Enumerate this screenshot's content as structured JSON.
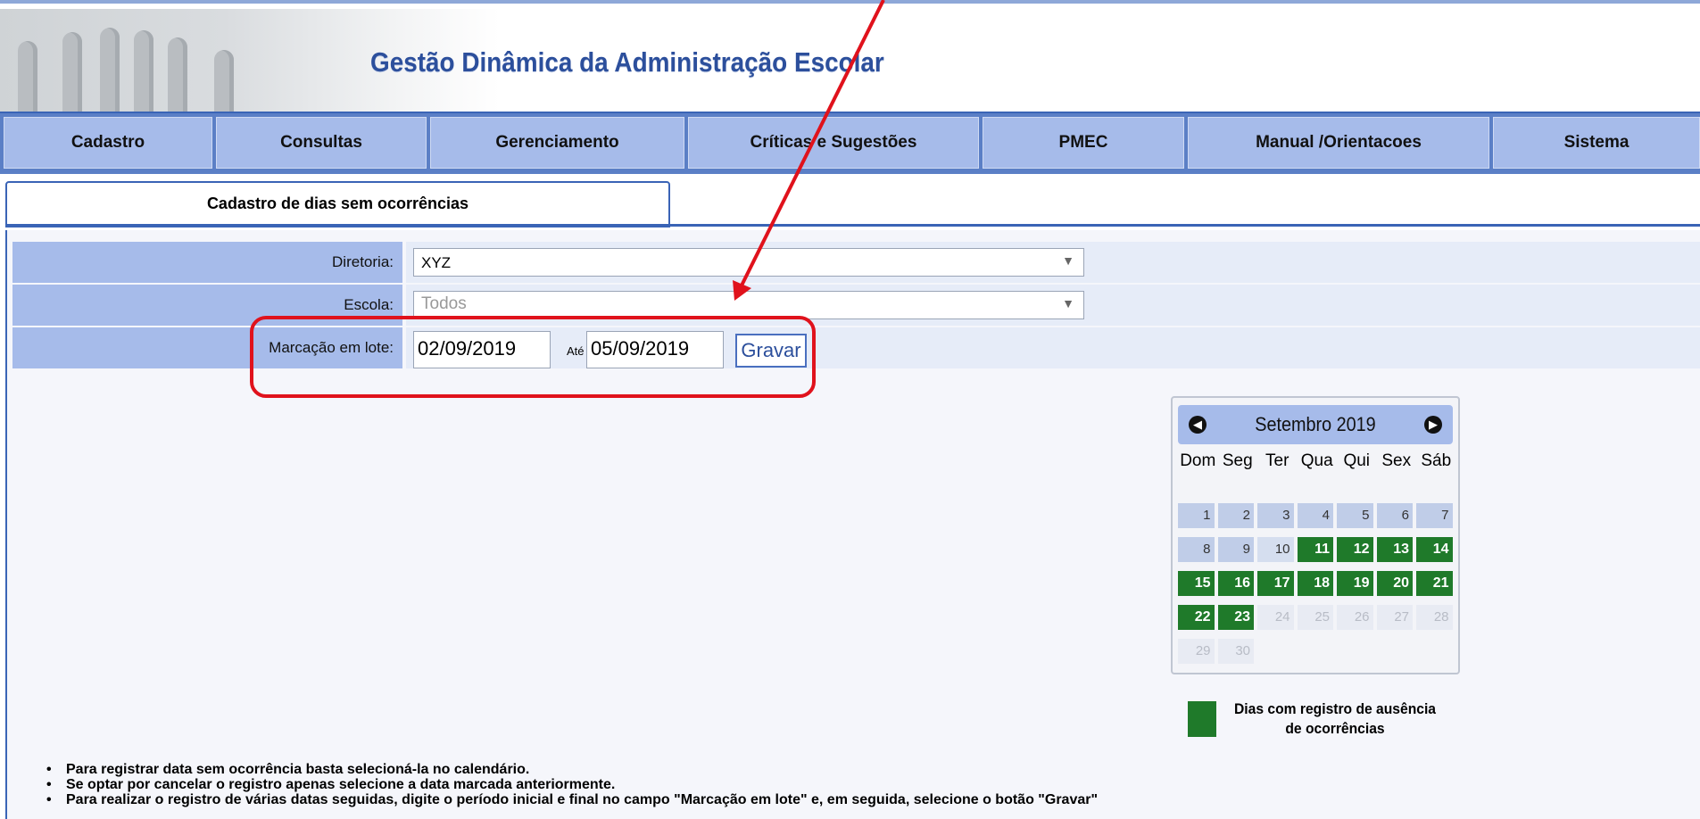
{
  "header": {
    "title": "Gestão Dinâmica da Administração Escolar"
  },
  "menu": [
    {
      "label": "Cadastro"
    },
    {
      "label": "Consultas"
    },
    {
      "label": "Gerenciamento"
    },
    {
      "label": "Críticas e Sugestões"
    },
    {
      "label": "PMEC"
    },
    {
      "label": "Manual /Orientacoes"
    },
    {
      "label": "Sistema"
    }
  ],
  "tab": {
    "label": "Cadastro de dias sem ocorrências"
  },
  "form": {
    "diretoria_label": "Diretoria:",
    "diretoria_value": "XYZ",
    "escola_label": "Escola:",
    "escola_value": "Todos",
    "lote_label": "Marcação em lote:",
    "date_from": "02/09/2019",
    "ate_label": "Até",
    "date_to": "05/09/2019",
    "gravar_label": "Gravar"
  },
  "calendar": {
    "title": "Setembro 2019",
    "prev_icon": "chevron-left-icon",
    "next_icon": "chevron-right-icon",
    "weekdays": [
      "Dom",
      "Seg",
      "Ter",
      "Qua",
      "Qui",
      "Sex",
      "Sáb"
    ],
    "weeks": [
      [
        {
          "d": "1",
          "s": "plain"
        },
        {
          "d": "2",
          "s": "plain"
        },
        {
          "d": "3",
          "s": "plain"
        },
        {
          "d": "4",
          "s": "plain"
        },
        {
          "d": "5",
          "s": "plain"
        },
        {
          "d": "6",
          "s": "plain"
        },
        {
          "d": "7",
          "s": "plain"
        }
      ],
      [
        {
          "d": "8",
          "s": "plain"
        },
        {
          "d": "9",
          "s": "plain"
        },
        {
          "d": "10",
          "s": "plain-soft"
        },
        {
          "d": "11",
          "s": "green"
        },
        {
          "d": "12",
          "s": "green"
        },
        {
          "d": "13",
          "s": "green"
        },
        {
          "d": "14",
          "s": "green"
        }
      ],
      [
        {
          "d": "15",
          "s": "green"
        },
        {
          "d": "16",
          "s": "green"
        },
        {
          "d": "17",
          "s": "green"
        },
        {
          "d": "18",
          "s": "green"
        },
        {
          "d": "19",
          "s": "green"
        },
        {
          "d": "20",
          "s": "green"
        },
        {
          "d": "21",
          "s": "green"
        }
      ],
      [
        {
          "d": "22",
          "s": "green"
        },
        {
          "d": "23",
          "s": "green"
        },
        {
          "d": "24",
          "s": "future"
        },
        {
          "d": "25",
          "s": "future"
        },
        {
          "d": "26",
          "s": "future"
        },
        {
          "d": "27",
          "s": "future"
        },
        {
          "d": "28",
          "s": "future"
        }
      ],
      [
        {
          "d": "29",
          "s": "future"
        },
        {
          "d": "30",
          "s": "future"
        },
        {
          "d": "",
          "s": "empty"
        },
        {
          "d": "",
          "s": "empty"
        },
        {
          "d": "",
          "s": "empty"
        },
        {
          "d": "",
          "s": "empty"
        },
        {
          "d": "",
          "s": "empty"
        }
      ]
    ],
    "colors": {
      "marked": "#1f7a2a",
      "header": "#a6bbea"
    }
  },
  "legend": {
    "text": "Dias com registro de ausência de ocorrências"
  },
  "instructions": [
    "Para registrar data sem ocorrência basta selecioná-la no calendário.",
    "Se optar por cancelar o registro apenas selecione a data marcada anteriormente.",
    "Para realizar o registro de várias datas seguidas, digite o período inicial e final no campo \"Marcação em lote\" e, em seguida, selecione o botão \"Gravar\""
  ],
  "annotation": {
    "color": "#e0121c"
  }
}
